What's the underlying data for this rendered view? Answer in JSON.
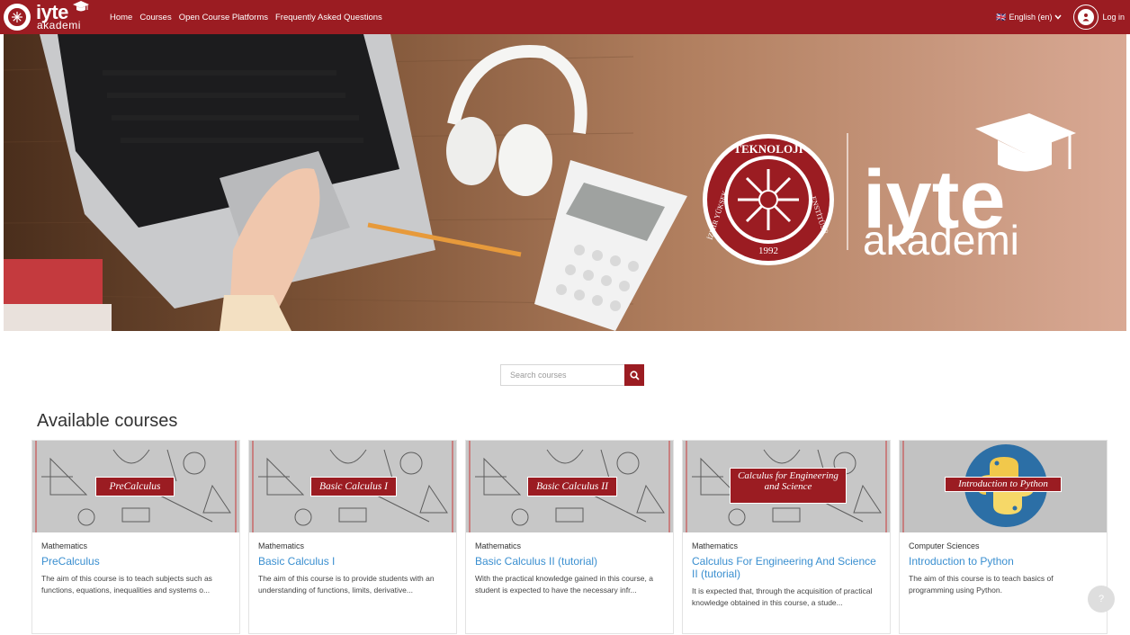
{
  "brand": {
    "name": "iyte",
    "sub": "akademi",
    "hero_seal_top": "TEKNOLOJİ",
    "hero_seal_left": "İZMİR YÜKSEK",
    "hero_seal_right": "ENSTİTÜSÜ",
    "hero_seal_year": "1992",
    "primary_color": "#9b1c22",
    "link_color": "#3a8fd0"
  },
  "nav": {
    "links": [
      "Home",
      "Courses",
      "Open Course Platforms",
      "Frequently Asked Questions"
    ],
    "language": "English (en)",
    "login": "Log in"
  },
  "search": {
    "placeholder": "Search courses"
  },
  "courses": {
    "heading": "Available courses",
    "items": [
      {
        "category": "Mathematics",
        "title": "PreCalculus",
        "banner": "PreCalculus",
        "description": "The aim of this course is to teach subjects such as functions, equations, inequalities and systems o..."
      },
      {
        "category": "Mathematics",
        "title": "Basic Calculus I",
        "banner": "Basic Calculus I",
        "description": "The aim of this course is to provide students with an understanding of functions, limits, derivative..."
      },
      {
        "category": "Mathematics",
        "title": "Basic Calculus II (tutorial)",
        "banner": "Basic Calculus II",
        "description": "With the practical knowledge gained in this course, a student is expected to have the necessary infr..."
      },
      {
        "category": "Mathematics",
        "title": "Calculus For Engineering And Science II (tutorial)",
        "banner": "Calculus for Engineering and Science",
        "description": "It is expected that, through the acquisition of practical knowledge obtained in this course, a stude..."
      },
      {
        "category": "Computer Sciences",
        "title": "Introduction to Python",
        "banner": "Introduction to Python",
        "description": "The aim of this course is to teach basics of programming using Python."
      }
    ]
  },
  "help": {
    "label": "?"
  }
}
